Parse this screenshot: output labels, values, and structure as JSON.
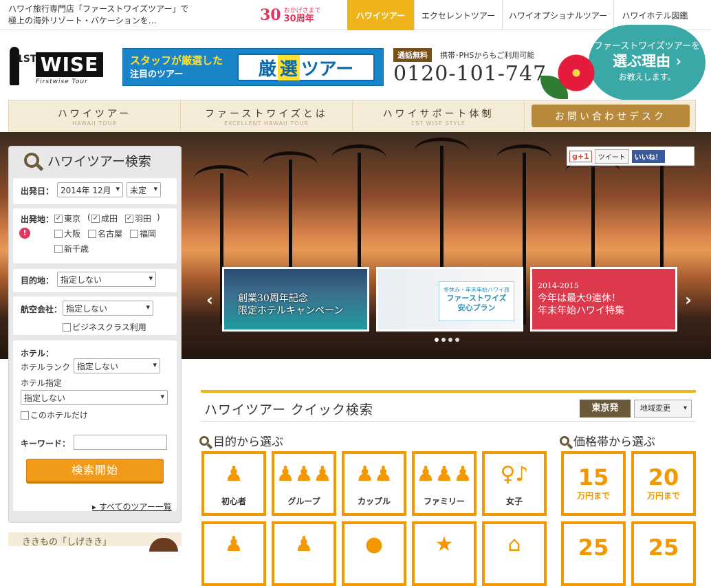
{
  "topbar": {
    "tagline_line1": "ハワイ旅行専門店「ファーストワイズツアー」で",
    "tagline_line2": "極上の海外リゾート・バケーションを…",
    "anniversary_num": "30",
    "anniversary_small": "おかげさまで",
    "anniversary_text": "30周年",
    "tabs": [
      "ハワイツアー",
      "エクセレントツアー",
      "ハワイオプショナルツアー",
      "ハワイホテル図鑑"
    ]
  },
  "header": {
    "logo_st": "1ST",
    "logo_wise": "WISE",
    "logo_sub": "Firstwise Tour",
    "banner_line1": "スタッフが厳選した",
    "banner_line2": "注目のツアー",
    "banner_k1": "厳",
    "banner_k2": "選",
    "banner_k3": "ツアー",
    "phone_badge": "通話無料",
    "phone_desc": "携帯･PHSからもご利用可能",
    "phone_number": "0120-101-747",
    "reason_a": "ファーストワイズツアーを",
    "reason_b": "選ぶ理由 ›",
    "reason_c": "お教えします。"
  },
  "mainnav": [
    {
      "jp": "ハワイツアー",
      "en": "HAWAII TOUR"
    },
    {
      "jp": "ファーストワイズとは",
      "en": "EXCELLENT HAWAII TOUR"
    },
    {
      "jp": "ハワイサポート体制",
      "en": "1ST WISE STYLE"
    }
  ],
  "contact_label": "お問い合わせデスク",
  "social": {
    "gplus": "g+1",
    "tweet": "ツイート",
    "like": "いいね！"
  },
  "slides": {
    "s1_line1": "創業30周年記念",
    "s1_line2": "限定ホテルキャンペーン",
    "s2_small": "冬休み・年末年始ハワイ旅",
    "s2_line1": "ファーストワイズ",
    "s2_line2": "安心プラン",
    "s3_year": "2014-2015",
    "s3_line1": "今年は最大9連休！",
    "s3_line2": "年末年始ハワイ特集"
  },
  "search": {
    "title": "ハワイツアー検索",
    "depart_label": "出発日：",
    "depart_month": "2014年 12月",
    "depart_day": "未定",
    "origin_label": "出発地：",
    "origins": [
      "東京",
      "成田",
      "羽田",
      "大阪",
      "名古屋",
      "福岡",
      "新千歳"
    ],
    "bracket_open": "(",
    "bracket_close": ")",
    "dest_label": "目的地：",
    "dest_value": "指定しない",
    "airline_label": "航空会社：",
    "airline_value": "指定しない",
    "business_label": "ビジネスクラス利用",
    "hotel_label": "ホテル：",
    "hotel_rank_label": "ホテルランク",
    "hotel_rank_value": "指定しない",
    "hotel_spec_label": "ホテル指定",
    "hotel_spec_value": "指定しない",
    "this_hotel_only": "このホテルだけ",
    "keyword_label": "キーワード：",
    "submit": "検索開始",
    "all_tours": "すべてのツアー一覧"
  },
  "promo_text": "ききもの「しげきき」",
  "quick": {
    "title": "ハワイツアー クイック検索",
    "region": "東京発",
    "region_change": "地域変更",
    "purpose_head": "目的から選ぶ",
    "price_head": "価格帯から選ぶ",
    "purposes": [
      "初心者",
      "グループ",
      "カップル",
      "ファミリー",
      "女子"
    ],
    "prices": [
      {
        "num": "15",
        "unit": "万円まで"
      },
      {
        "num": "20",
        "unit": "万円まで"
      }
    ],
    "row2_prices": [
      "25",
      "25"
    ]
  },
  "colors": {
    "accent": "#eeb419",
    "orange": "#f39800",
    "brown": "#6b5a3a",
    "teal": "#3aa8a6"
  }
}
